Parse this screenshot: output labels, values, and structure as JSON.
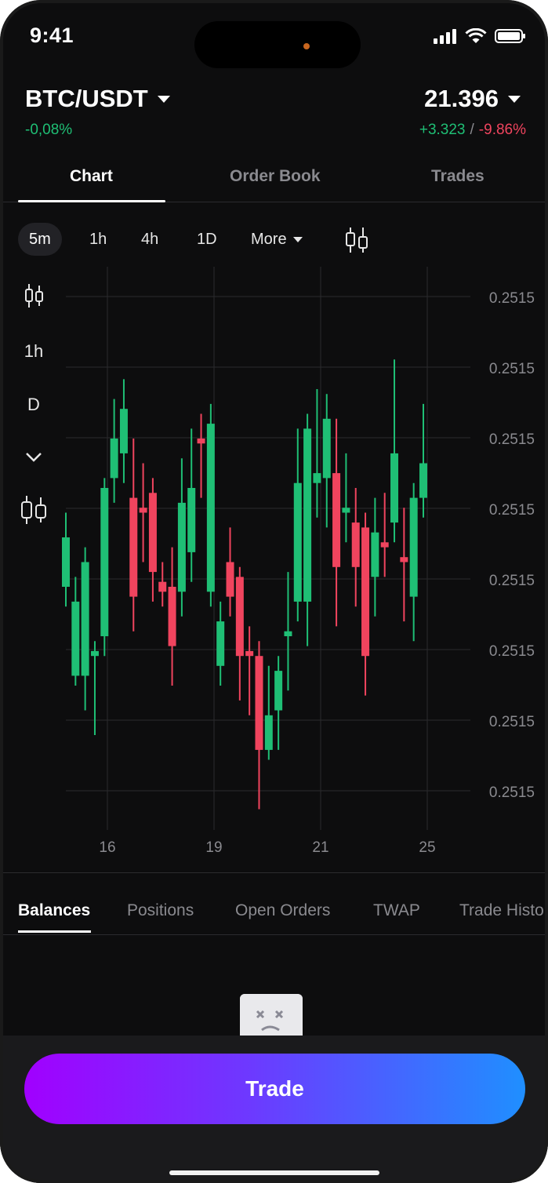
{
  "status_bar": {
    "time": "9:41"
  },
  "header": {
    "pair": "BTC/USDT",
    "pair_change": "-0,08%",
    "price": "21.396",
    "abs_change": "+3.323",
    "separator": "/",
    "pct_change": "-9.86%"
  },
  "tabs": [
    {
      "label": "Chart",
      "active": true
    },
    {
      "label": "Order Book",
      "active": false
    },
    {
      "label": "Trades",
      "active": false
    }
  ],
  "timeframes": [
    {
      "label": "5m",
      "active": true
    },
    {
      "label": "1h",
      "active": false
    },
    {
      "label": "4h",
      "active": false
    },
    {
      "label": "1D",
      "active": false
    }
  ],
  "more_label": "More",
  "side_tools": {
    "interval": "1h",
    "drawing": "D"
  },
  "chart_data": {
    "type": "candlestick",
    "y_tick_labels": [
      "0.2515",
      "0.2515",
      "0.2515",
      "0.2515",
      "0.2515",
      "0.2515",
      "0.2515",
      "0.2515"
    ],
    "x_tick_labels": [
      "16",
      "19",
      "21",
      "25"
    ],
    "grid": true,
    "up_color": "#1fbf75",
    "down_color": "#f0445e",
    "candles": [
      {
        "o": 0.4,
        "c": 0.5,
        "h": 0.55,
        "l": 0.36
      },
      {
        "o": 0.22,
        "c": 0.37,
        "h": 0.42,
        "l": 0.2
      },
      {
        "o": 0.22,
        "c": 0.45,
        "h": 0.48,
        "l": 0.15
      },
      {
        "o": 0.26,
        "c": 0.27,
        "h": 0.29,
        "l": 0.1
      },
      {
        "o": 0.3,
        "c": 0.6,
        "h": 0.62,
        "l": 0.26
      },
      {
        "o": 0.62,
        "c": 0.7,
        "h": 0.78,
        "l": 0.57
      },
      {
        "o": 0.67,
        "c": 0.76,
        "h": 0.82,
        "l": 0.61
      },
      {
        "o": 0.58,
        "c": 0.38,
        "h": 0.7,
        "l": 0.31
      },
      {
        "o": 0.56,
        "c": 0.55,
        "h": 0.65,
        "l": 0.45
      },
      {
        "o": 0.59,
        "c": 0.43,
        "h": 0.62,
        "l": 0.37
      },
      {
        "o": 0.41,
        "c": 0.39,
        "h": 0.45,
        "l": 0.36
      },
      {
        "o": 0.4,
        "c": 0.28,
        "h": 0.48,
        "l": 0.2
      },
      {
        "o": 0.39,
        "c": 0.57,
        "h": 0.66,
        "l": 0.34
      },
      {
        "o": 0.47,
        "c": 0.6,
        "h": 0.72,
        "l": 0.41
      },
      {
        "o": 0.7,
        "c": 0.69,
        "h": 0.75,
        "l": 0.58
      },
      {
        "o": 0.39,
        "c": 0.73,
        "h": 0.77,
        "l": 0.36
      },
      {
        "o": 0.24,
        "c": 0.33,
        "h": 0.37,
        "l": 0.2
      },
      {
        "o": 0.45,
        "c": 0.38,
        "h": 0.52,
        "l": 0.34
      },
      {
        "o": 0.42,
        "c": 0.26,
        "h": 0.44,
        "l": 0.17
      },
      {
        "o": 0.27,
        "c": 0.26,
        "h": 0.32,
        "l": 0.14
      },
      {
        "o": 0.26,
        "c": 0.07,
        "h": 0.29,
        "l": -0.05
      },
      {
        "o": 0.07,
        "c": 0.14,
        "h": 0.24,
        "l": 0.05
      },
      {
        "o": 0.15,
        "c": 0.23,
        "h": 0.26,
        "l": 0.07
      },
      {
        "o": 0.3,
        "c": 0.31,
        "h": 0.43,
        "l": 0.19
      },
      {
        "o": 0.37,
        "c": 0.61,
        "h": 0.72,
        "l": 0.33
      },
      {
        "o": 0.37,
        "c": 0.72,
        "h": 0.75,
        "l": 0.28
      },
      {
        "o": 0.61,
        "c": 0.63,
        "h": 0.8,
        "l": 0.54
      },
      {
        "o": 0.62,
        "c": 0.74,
        "h": 0.79,
        "l": 0.52
      },
      {
        "o": 0.63,
        "c": 0.44,
        "h": 0.74,
        "l": 0.32
      },
      {
        "o": 0.55,
        "c": 0.56,
        "h": 0.67,
        "l": 0.49
      },
      {
        "o": 0.53,
        "c": 0.44,
        "h": 0.6,
        "l": 0.36
      },
      {
        "o": 0.52,
        "c": 0.26,
        "h": 0.55,
        "l": 0.18
      },
      {
        "o": 0.42,
        "c": 0.51,
        "h": 0.58,
        "l": 0.34
      },
      {
        "o": 0.49,
        "c": 0.48,
        "h": 0.59,
        "l": 0.42
      },
      {
        "o": 0.53,
        "c": 0.67,
        "h": 0.86,
        "l": 0.49
      },
      {
        "o": 0.46,
        "c": 0.45,
        "h": 0.56,
        "l": 0.33
      },
      {
        "o": 0.38,
        "c": 0.58,
        "h": 0.61,
        "l": 0.29
      },
      {
        "o": 0.58,
        "c": 0.65,
        "h": 0.77,
        "l": 0.54
      }
    ]
  },
  "bottom_tabs": [
    {
      "label": "Balances",
      "active": true
    },
    {
      "label": "Positions",
      "active": false
    },
    {
      "label": "Open Orders",
      "active": false
    },
    {
      "label": "TWAP",
      "active": false
    },
    {
      "label": "Trade History",
      "active": false
    }
  ],
  "trade_button": "Trade"
}
